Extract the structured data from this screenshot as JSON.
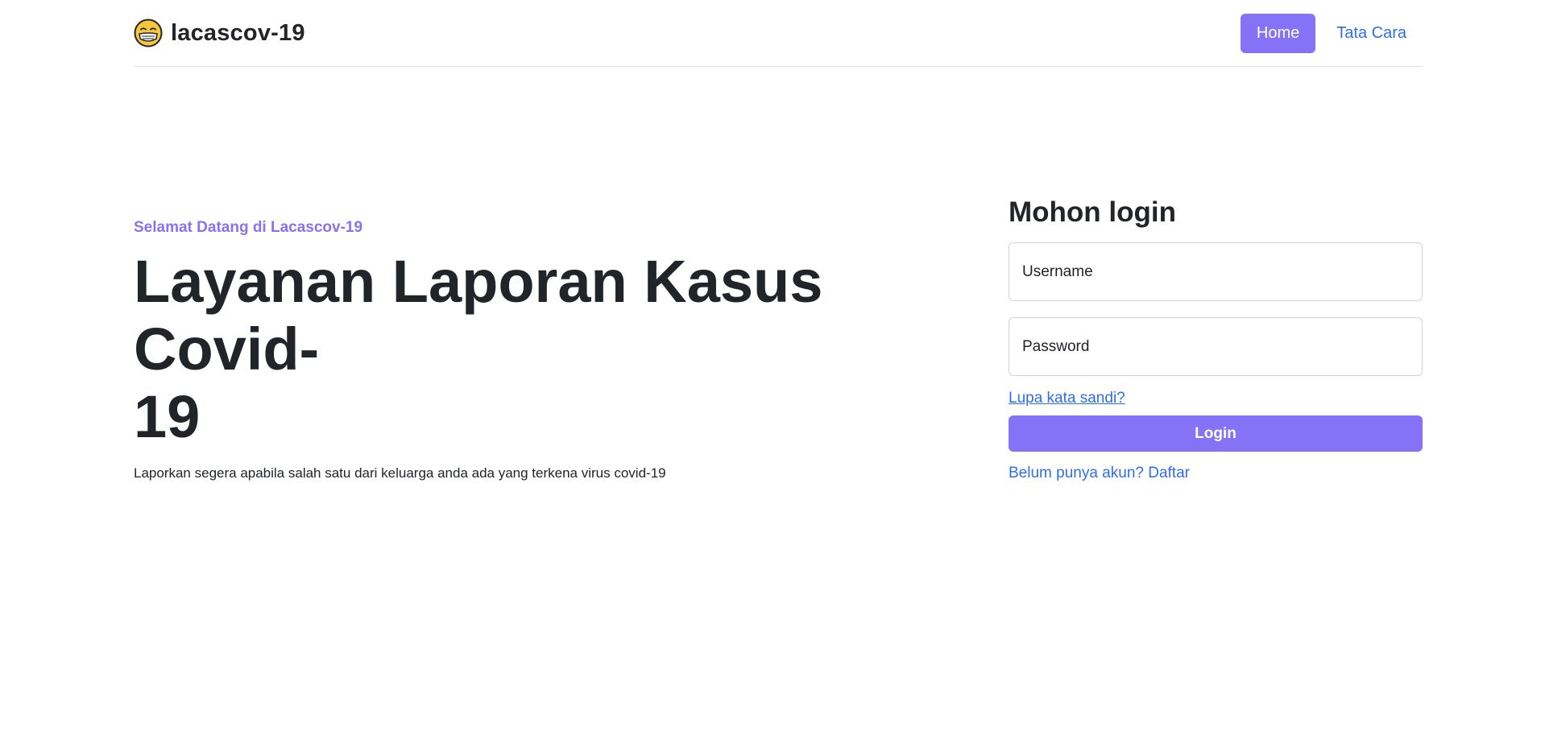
{
  "header": {
    "brand_text": "lacascov-19",
    "brand_icon": "face-with-mask-icon",
    "nav": {
      "home_label": "Home",
      "guide_label": "Tata Cara"
    }
  },
  "hero": {
    "eyebrow": "Selamat Datang di Lacascov-19",
    "title_line1": "Layanan Laporan Kasus Covid-",
    "title_line2": "19",
    "description": "Laporkan segera apabila salah satu dari keluarga anda ada yang terkena virus covid-19"
  },
  "login": {
    "title": "Mohon login",
    "username_placeholder": "Username",
    "password_placeholder": "Password",
    "forgot_label": "Lupa kata sandi?",
    "submit_label": "Login",
    "register_label": "Belum punya akun? Daftar"
  },
  "colors": {
    "accent": "#8672f7",
    "eyebrow": "#8a71f0",
    "link": "#2f6fe6",
    "text": "#212529",
    "border": "#dee2e6"
  }
}
